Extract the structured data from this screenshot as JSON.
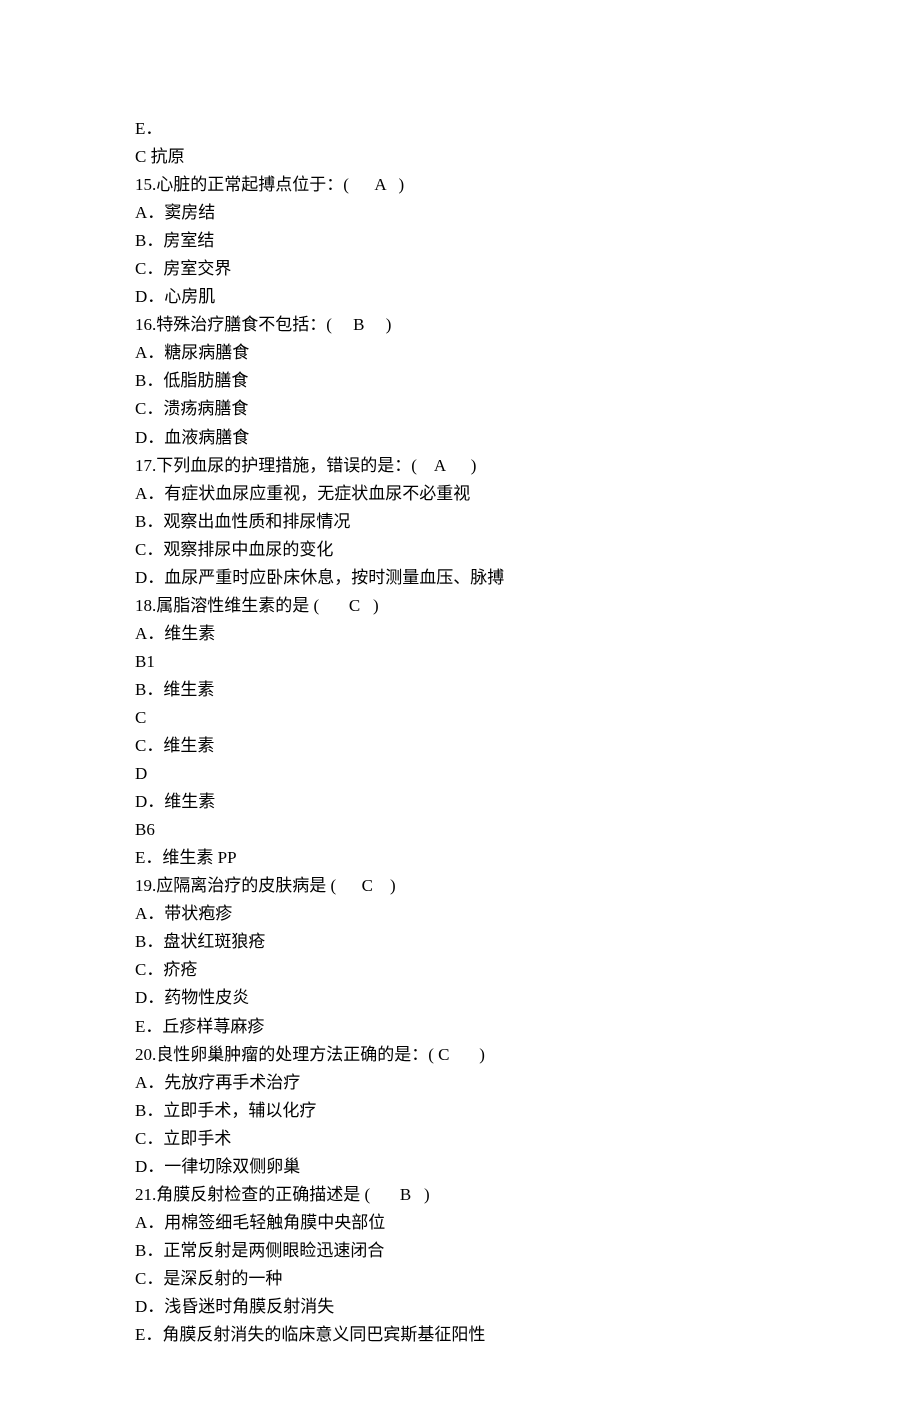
{
  "lines": [
    "E．",
    "C 抗原",
    "15.心脏的正常起搏点位于：(      A   )",
    "A．窦房结",
    "B．房室结",
    "C．房室交界",
    "D．心房肌",
    "16.特殊治疗膳食不包括：(     B     )",
    "A．糖尿病膳食",
    "B．低脂肪膳食",
    "C．溃疡病膳食",
    "D．血液病膳食",
    "17.下列血尿的护理措施，错误的是：(    A      )",
    "A．有症状血尿应重视，无症状血尿不必重视",
    "B．观察出血性质和排尿情况",
    "C．观察排尿中血尿的变化",
    "D．血尿严重时应卧床休息，按时测量血压、脉搏",
    "18.属脂溶性维生素的是 (       C   )",
    "A．维生素",
    "B1",
    "B．维生素",
    "C",
    "C．维生素",
    "D",
    "D．维生素",
    "B6",
    "E．维生素 PP",
    "19.应隔离治疗的皮肤病是 (      C    )",
    "A．带状疱疹",
    "B．盘状红斑狼疮",
    "C．疥疮",
    "D．药物性皮炎",
    "E．丘疹样荨麻疹",
    "20.良性卵巢肿瘤的处理方法正确的是：( C       )",
    "A．先放疗再手术治疗",
    "B．立即手术，辅以化疗",
    "C．立即手术",
    "D．一律切除双侧卵巢",
    "21.角膜反射检查的正确描述是 (       B   )",
    "A．用棉签细毛轻触角膜中央部位",
    "B．正常反射是两侧眼睑迅速闭合",
    "C．是深反射的一种",
    "D．浅昏迷时角膜反射消失",
    "E．角膜反射消失的临床意义同巴宾斯基征阳性"
  ]
}
